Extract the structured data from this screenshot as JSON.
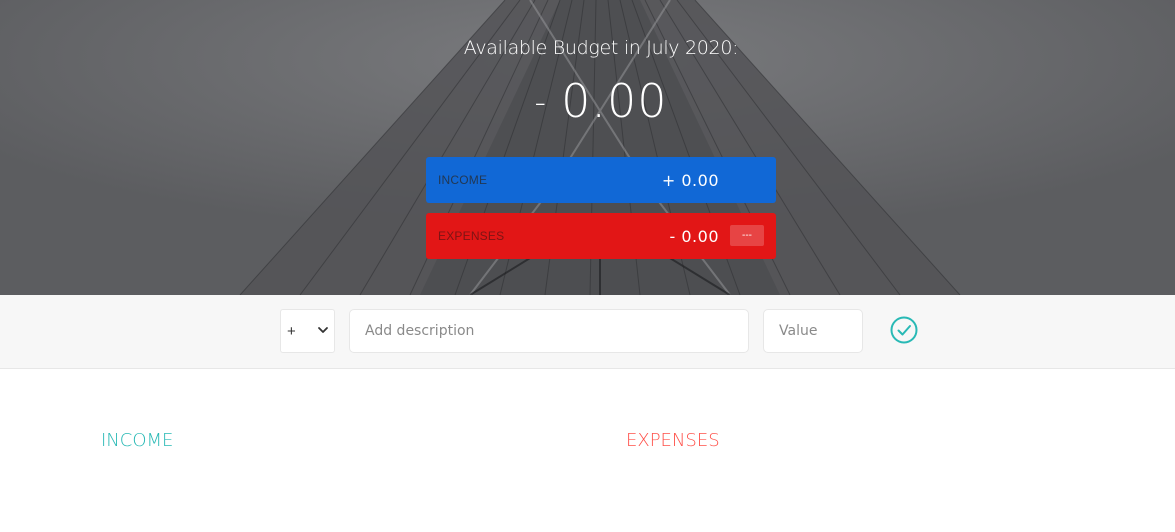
{
  "header": {
    "title": "Available Budget in July 2020:",
    "budget_sign": "-",
    "budget_amount": "0.00"
  },
  "summary": {
    "income": {
      "label": "Income",
      "amount": "+ 0.00",
      "color": "#1168d6"
    },
    "expenses": {
      "label": "Expenses",
      "amount": "- 0.00",
      "percentage": "---",
      "color": "#e21616"
    }
  },
  "add_bar": {
    "type_selected": "+",
    "type_options": [
      "+",
      "-"
    ],
    "description_placeholder": "Add description",
    "value_placeholder": "Value",
    "submit_icon": "check-circle-icon",
    "accent": "#28b9b5"
  },
  "lists": {
    "income_title": "Income",
    "expenses_title": "Expenses",
    "income_color": "#28b9b5",
    "expenses_color": "#ff5049"
  }
}
